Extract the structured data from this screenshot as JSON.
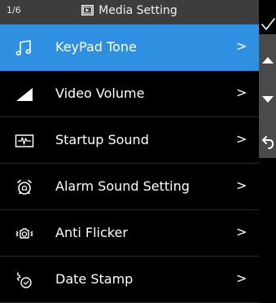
{
  "header": {
    "page_counter": "1/6",
    "title": "Media Setting",
    "title_icon": "media-icon"
  },
  "menu": {
    "items": [
      {
        "label": "KeyPad Tone",
        "icon": "music-note-icon",
        "selected": true
      },
      {
        "label": "Video Volume",
        "icon": "volume-ramp-icon",
        "selected": false
      },
      {
        "label": "Startup Sound",
        "icon": "waveform-box-icon",
        "selected": false
      },
      {
        "label": "Alarm Sound Setting",
        "icon": "alarm-bell-icon",
        "selected": false
      },
      {
        "label": "Anti Flicker",
        "icon": "anti-flicker-icon",
        "selected": false
      },
      {
        "label": "Date Stamp",
        "icon": "date-stamp-icon",
        "selected": false
      }
    ],
    "chevron": ">"
  },
  "rail": {
    "confirm_icon": "checkmark-icon",
    "up_icon": "arrow-up-icon",
    "down_icon": "arrow-down-icon",
    "back_icon": "back-icon"
  },
  "colors": {
    "header_bg": "#3d3d3d",
    "selected_bg": "#2f8fe0",
    "rail_gray": "#4a4a4a"
  }
}
